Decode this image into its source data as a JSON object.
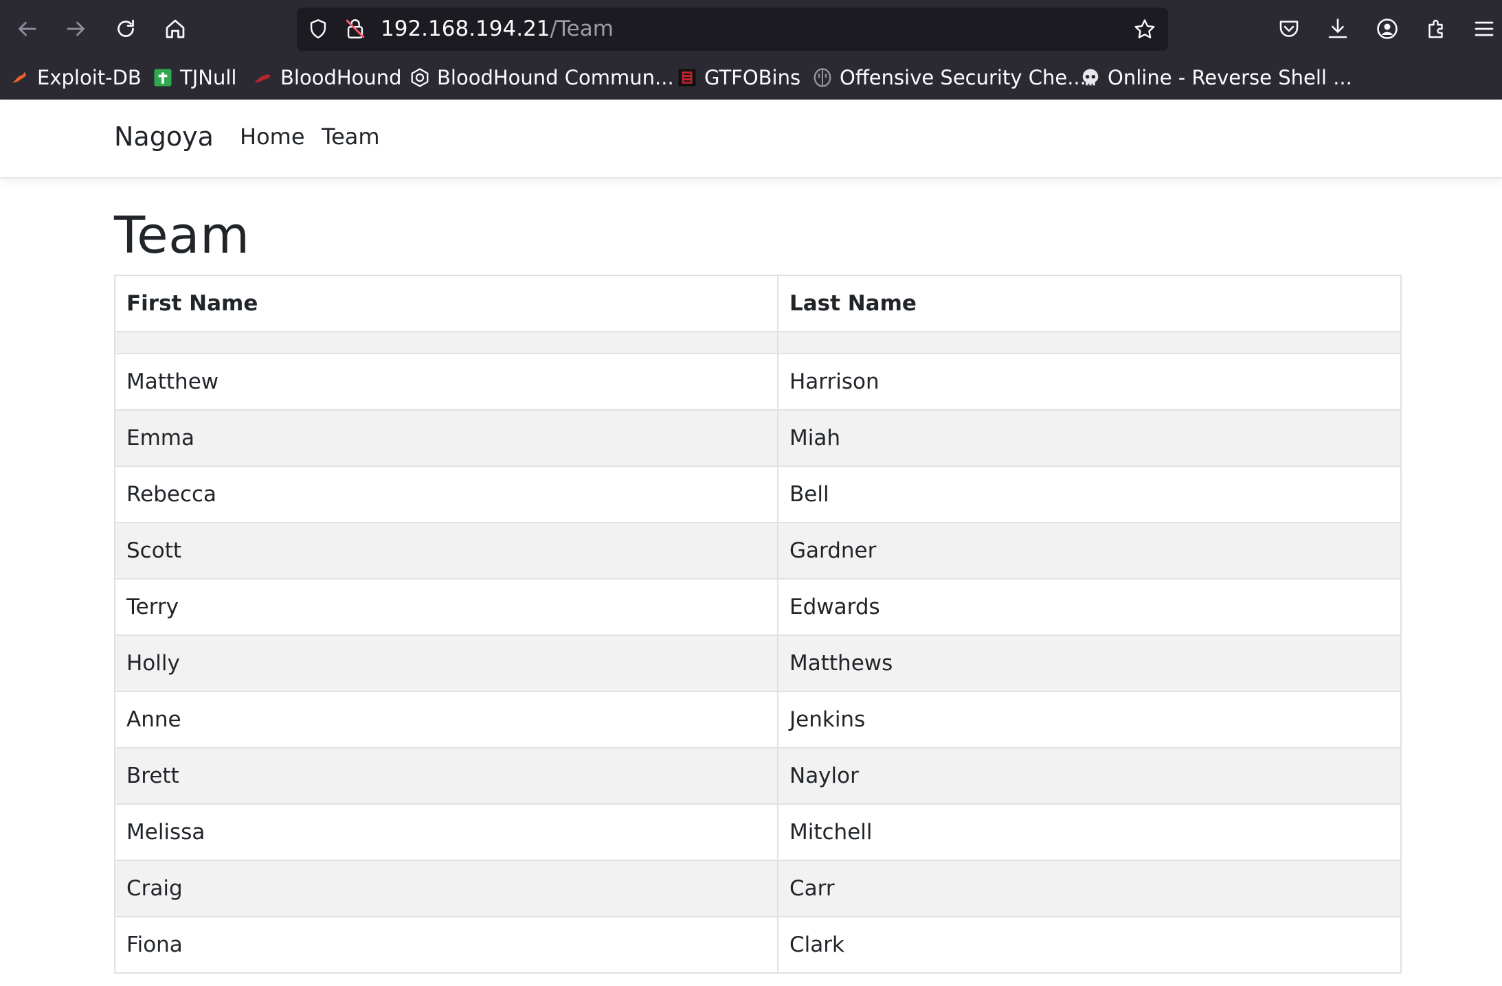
{
  "browser": {
    "url_host": "192.168.194.21",
    "url_path": "/Team",
    "bookmarks": [
      {
        "label": "Exploit-DB",
        "icon": "exploit-db-icon"
      },
      {
        "label": "TJNull",
        "icon": "plus-green-icon"
      },
      {
        "label": "BloodHound",
        "icon": "bloodhound-icon"
      },
      {
        "label": "BloodHound Commun...",
        "icon": "bloodhound-hex-icon"
      },
      {
        "label": "GTFOBins",
        "icon": "gtfobins-icon"
      },
      {
        "label": "Offensive Security Che...",
        "icon": "brain-icon"
      },
      {
        "label": "Online - Reverse Shell ...",
        "icon": "skull-icon"
      }
    ]
  },
  "site": {
    "brand": "Nagoya",
    "nav": [
      {
        "label": "Home"
      },
      {
        "label": "Team"
      }
    ]
  },
  "page": {
    "title": "Team",
    "table": {
      "headers": [
        "First Name",
        "Last Name"
      ],
      "rows": [
        [
          "Matthew",
          "Harrison"
        ],
        [
          "Emma",
          "Miah"
        ],
        [
          "Rebecca",
          "Bell"
        ],
        [
          "Scott",
          "Gardner"
        ],
        [
          "Terry",
          "Edwards"
        ],
        [
          "Holly",
          "Matthews"
        ],
        [
          "Anne",
          "Jenkins"
        ],
        [
          "Brett",
          "Naylor"
        ],
        [
          "Melissa",
          "Mitchell"
        ],
        [
          "Craig",
          "Carr"
        ],
        [
          "Fiona",
          "Clark"
        ]
      ]
    }
  },
  "colors": {
    "chrome_bg": "#2b2a33",
    "urlbar_bg": "#1c1b22",
    "row_stripe": "#f2f2f2",
    "border": "#dee2e6",
    "text": "#212529"
  }
}
